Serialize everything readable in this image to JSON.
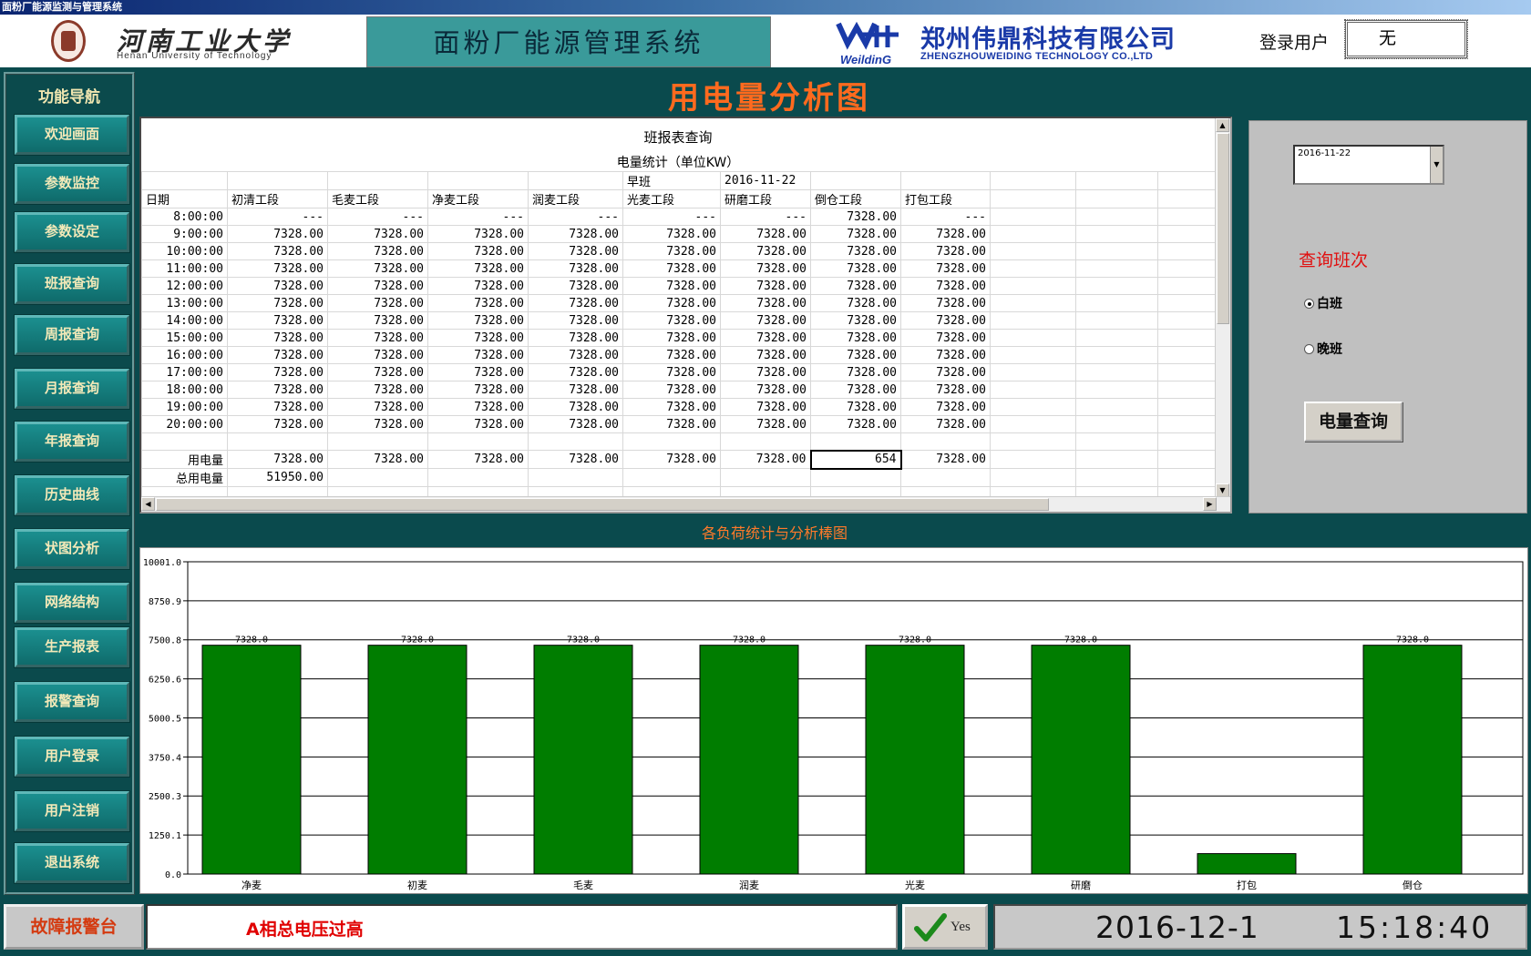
{
  "window": {
    "title": "面粉厂能源监测与管理系统"
  },
  "header": {
    "university_cn": "河南工业大学",
    "university_en": "Henan University of Technology",
    "system_title": "面粉厂能源管理系统",
    "company_cn": "郑州伟鼎科技有限公司",
    "company_en": "ZHENGZHOUWEIDING TECHNOLOGY CO.,LTD",
    "company_logo_text": "WeildinG",
    "user_label": "登录用户",
    "user_value": "无"
  },
  "sidebar": {
    "title": "功能导航",
    "items": [
      "欢迎画面",
      "参数监控",
      "参数设定",
      "班报查询",
      "周报查询",
      "月报查询",
      "年报查询",
      "历史曲线",
      "状图分析",
      "网络结构",
      "生产报表",
      "报警查询",
      "用户登录",
      "用户注销",
      "退出系统"
    ]
  },
  "page_title": "用电量分析图",
  "report": {
    "title": "班报表查询",
    "subtitle": "电量统计（单位KW）",
    "shift_label": "早班",
    "date_label": "2016-11-22",
    "headers": [
      "日期",
      "初清工段",
      "毛麦工段",
      "净麦工段",
      "润麦工段",
      "光麦工段",
      "研磨工段",
      "倒仓工段",
      "打包工段"
    ],
    "rows": [
      [
        "8:00:00",
        "---",
        "---",
        "---",
        "---",
        "---",
        "---",
        "7328.00",
        "---"
      ],
      [
        "9:00:00",
        "7328.00",
        "7328.00",
        "7328.00",
        "7328.00",
        "7328.00",
        "7328.00",
        "7328.00",
        "7328.00"
      ],
      [
        "10:00:00",
        "7328.00",
        "7328.00",
        "7328.00",
        "7328.00",
        "7328.00",
        "7328.00",
        "7328.00",
        "7328.00"
      ],
      [
        "11:00:00",
        "7328.00",
        "7328.00",
        "7328.00",
        "7328.00",
        "7328.00",
        "7328.00",
        "7328.00",
        "7328.00"
      ],
      [
        "12:00:00",
        "7328.00",
        "7328.00",
        "7328.00",
        "7328.00",
        "7328.00",
        "7328.00",
        "7328.00",
        "7328.00"
      ],
      [
        "13:00:00",
        "7328.00",
        "7328.00",
        "7328.00",
        "7328.00",
        "7328.00",
        "7328.00",
        "7328.00",
        "7328.00"
      ],
      [
        "14:00:00",
        "7328.00",
        "7328.00",
        "7328.00",
        "7328.00",
        "7328.00",
        "7328.00",
        "7328.00",
        "7328.00"
      ],
      [
        "15:00:00",
        "7328.00",
        "7328.00",
        "7328.00",
        "7328.00",
        "7328.00",
        "7328.00",
        "7328.00",
        "7328.00"
      ],
      [
        "16:00:00",
        "7328.00",
        "7328.00",
        "7328.00",
        "7328.00",
        "7328.00",
        "7328.00",
        "7328.00",
        "7328.00"
      ],
      [
        "17:00:00",
        "7328.00",
        "7328.00",
        "7328.00",
        "7328.00",
        "7328.00",
        "7328.00",
        "7328.00",
        "7328.00"
      ],
      [
        "18:00:00",
        "7328.00",
        "7328.00",
        "7328.00",
        "7328.00",
        "7328.00",
        "7328.00",
        "7328.00",
        "7328.00"
      ],
      [
        "19:00:00",
        "7328.00",
        "7328.00",
        "7328.00",
        "7328.00",
        "7328.00",
        "7328.00",
        "7328.00",
        "7328.00"
      ],
      [
        "20:00:00",
        "7328.00",
        "7328.00",
        "7328.00",
        "7328.00",
        "7328.00",
        "7328.00",
        "7328.00",
        "7328.00"
      ]
    ],
    "usage_label": "用电量",
    "usage_values": [
      "7328.00",
      "7328.00",
      "7328.00",
      "7328.00",
      "7328.00",
      "7328.00",
      "654",
      "7328.00"
    ],
    "total_label": "总用电量",
    "total_value": "51950.00"
  },
  "query_panel": {
    "date_value": "2016-11-22",
    "shift_query_label": "查询班次",
    "day_shift": "白班",
    "night_shift": "晚班",
    "selected_shift": "白班",
    "query_button": "电量查询"
  },
  "chart_title": "各负荷统计与分析棒图",
  "chart_data": {
    "type": "bar",
    "categories": [
      "净麦",
      "初麦",
      "毛麦",
      "润麦",
      "光麦",
      "研磨",
      "打包",
      "倒仓"
    ],
    "values": [
      7328.0,
      7328.0,
      7328.0,
      7328.0,
      7328.0,
      7328.0,
      654,
      7328.0
    ],
    "data_labels": [
      "7328.0",
      "7328.0",
      "7328.0",
      "7328.0",
      "7328.0",
      "7328.0",
      "",
      "7328.0"
    ],
    "yticks": [
      "0.0",
      "1250.1",
      "2500.3",
      "3750.4",
      "5000.5",
      "6250.6",
      "7500.8",
      "8750.9",
      "10001.0"
    ],
    "ylim": [
      0,
      10001.0
    ],
    "bar_color": "#007d00",
    "grid": true
  },
  "footer": {
    "alarm_label": "故障报警台",
    "alarm_message": "A相总电压过高",
    "ack_label": "Yes",
    "date": "2016-12-1",
    "time": "15:18:40"
  }
}
